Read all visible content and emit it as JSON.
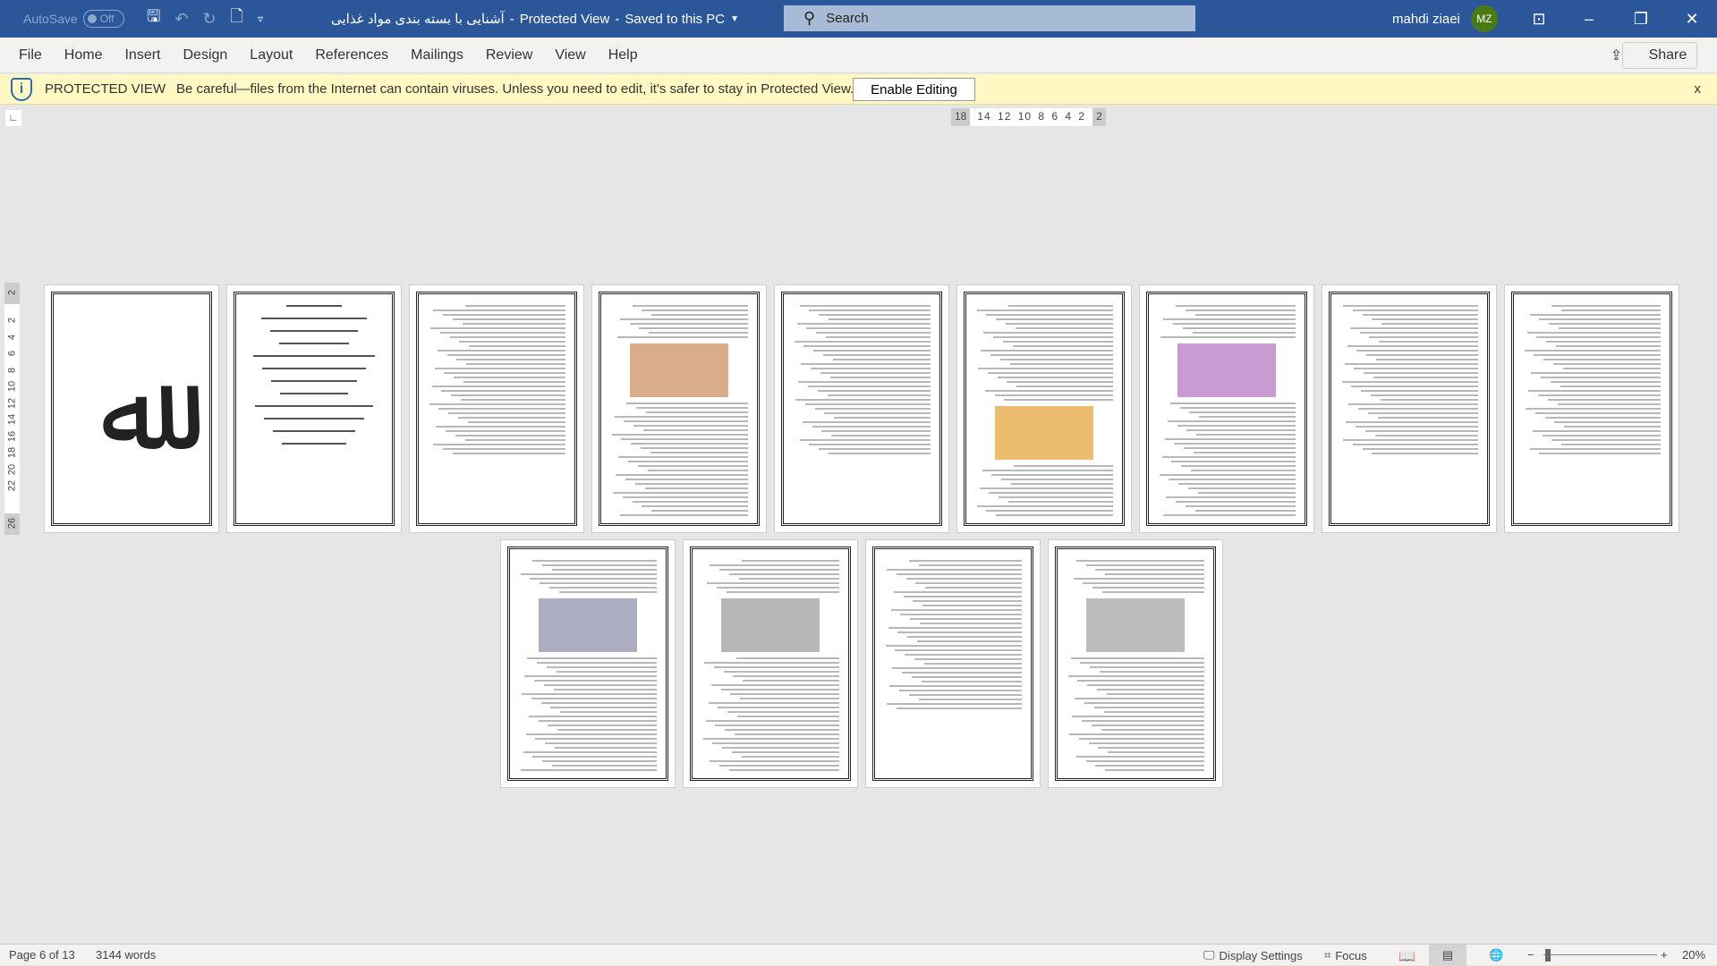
{
  "titlebar": {
    "autosave_label": "AutoSave",
    "autosave_state": "Off",
    "doc_title": "آشنایی با بسته بندی مواد غذایی",
    "separator": "-",
    "mode": "Protected View",
    "save_status": "Saved to this PC",
    "search_placeholder": "Search",
    "user_name": "mahdi ziaei",
    "user_initials": "MZ",
    "accent": "#2b579a"
  },
  "ribbon": {
    "tabs": [
      "File",
      "Home",
      "Insert",
      "Design",
      "Layout",
      "References",
      "Mailings",
      "Review",
      "View",
      "Help"
    ],
    "share": "Share"
  },
  "protected_bar": {
    "title": "PROTECTED VIEW",
    "message": "Be careful—files from the Internet can contain viruses. Unless you need to edit, it's safer to stay in Protected View.",
    "button": "Enable Editing",
    "close": "x"
  },
  "ruler": {
    "left": "18",
    "ticks": "14 12 10 8 6 4 2",
    "right": "2",
    "vertical_top": "2",
    "vertical": [
      "2",
      "4",
      "6",
      "8",
      "10",
      "12",
      "14",
      "16",
      "18",
      "20",
      "22"
    ],
    "vertical_bottom": "26"
  },
  "pages_count": 13,
  "status": {
    "page": "Page 6 of 13",
    "words": "3144 words",
    "display_settings": "Display Settings",
    "focus": "Focus",
    "zoom": "20%"
  }
}
